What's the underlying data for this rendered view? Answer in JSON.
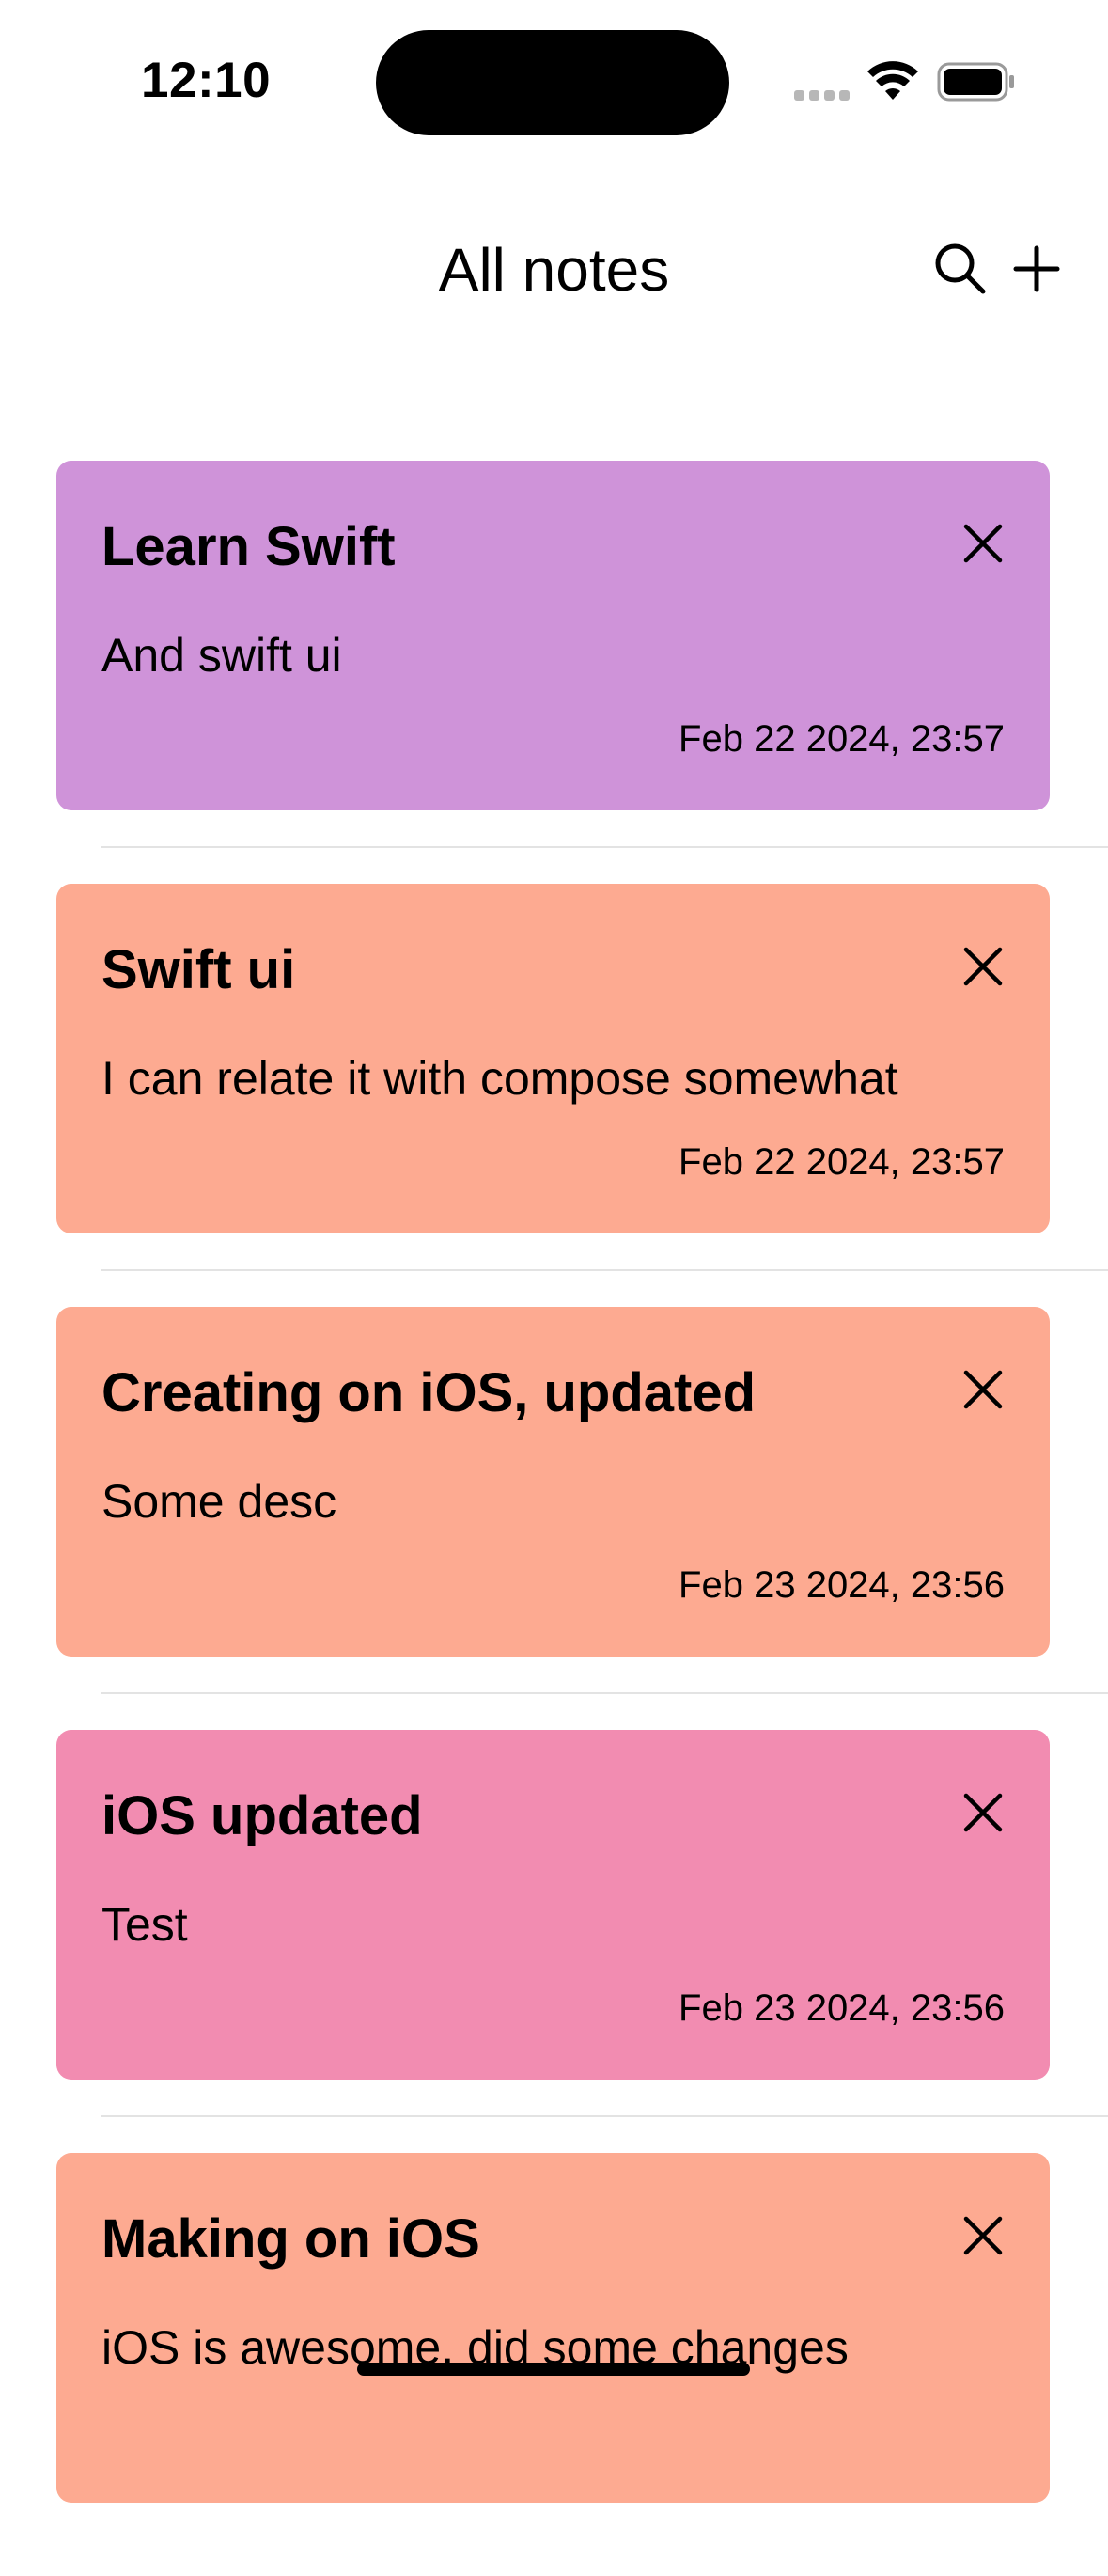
{
  "status_bar": {
    "time": "12:10",
    "icons": [
      "cellular-signal-icon",
      "wifi-icon",
      "battery-icon"
    ]
  },
  "nav": {
    "title": "All notes",
    "actions": [
      {
        "icon": "search-icon"
      },
      {
        "icon": "plus-icon"
      }
    ]
  },
  "notes": [
    {
      "title": "Learn Swift",
      "description": "And swift ui",
      "date": "Feb 22 2024, 23:57",
      "color": "#cf93d9",
      "close_icon": "close-icon"
    },
    {
      "title": "Swift ui",
      "description": "I can relate it with compose somewhat",
      "date": "Feb 22 2024, 23:57",
      "color": "#fdaa91",
      "close_icon": "close-icon"
    },
    {
      "title": "Creating on iOS, updated",
      "description": "Some desc",
      "date": "Feb 23 2024, 23:56",
      "color": "#fdaa91",
      "close_icon": "close-icon"
    },
    {
      "title": "iOS updated",
      "description": "Test",
      "date": "Feb 23 2024, 23:56",
      "color": "#f28cb1",
      "close_icon": "close-icon"
    },
    {
      "title": "Making on iOS",
      "description": "iOS is awesome, did some changes",
      "date": "",
      "color": "#fdaa91",
      "close_icon": "close-icon"
    }
  ],
  "colors": {
    "background": "#ffffff",
    "text": "#000000",
    "divider": "#e3e3e3"
  }
}
